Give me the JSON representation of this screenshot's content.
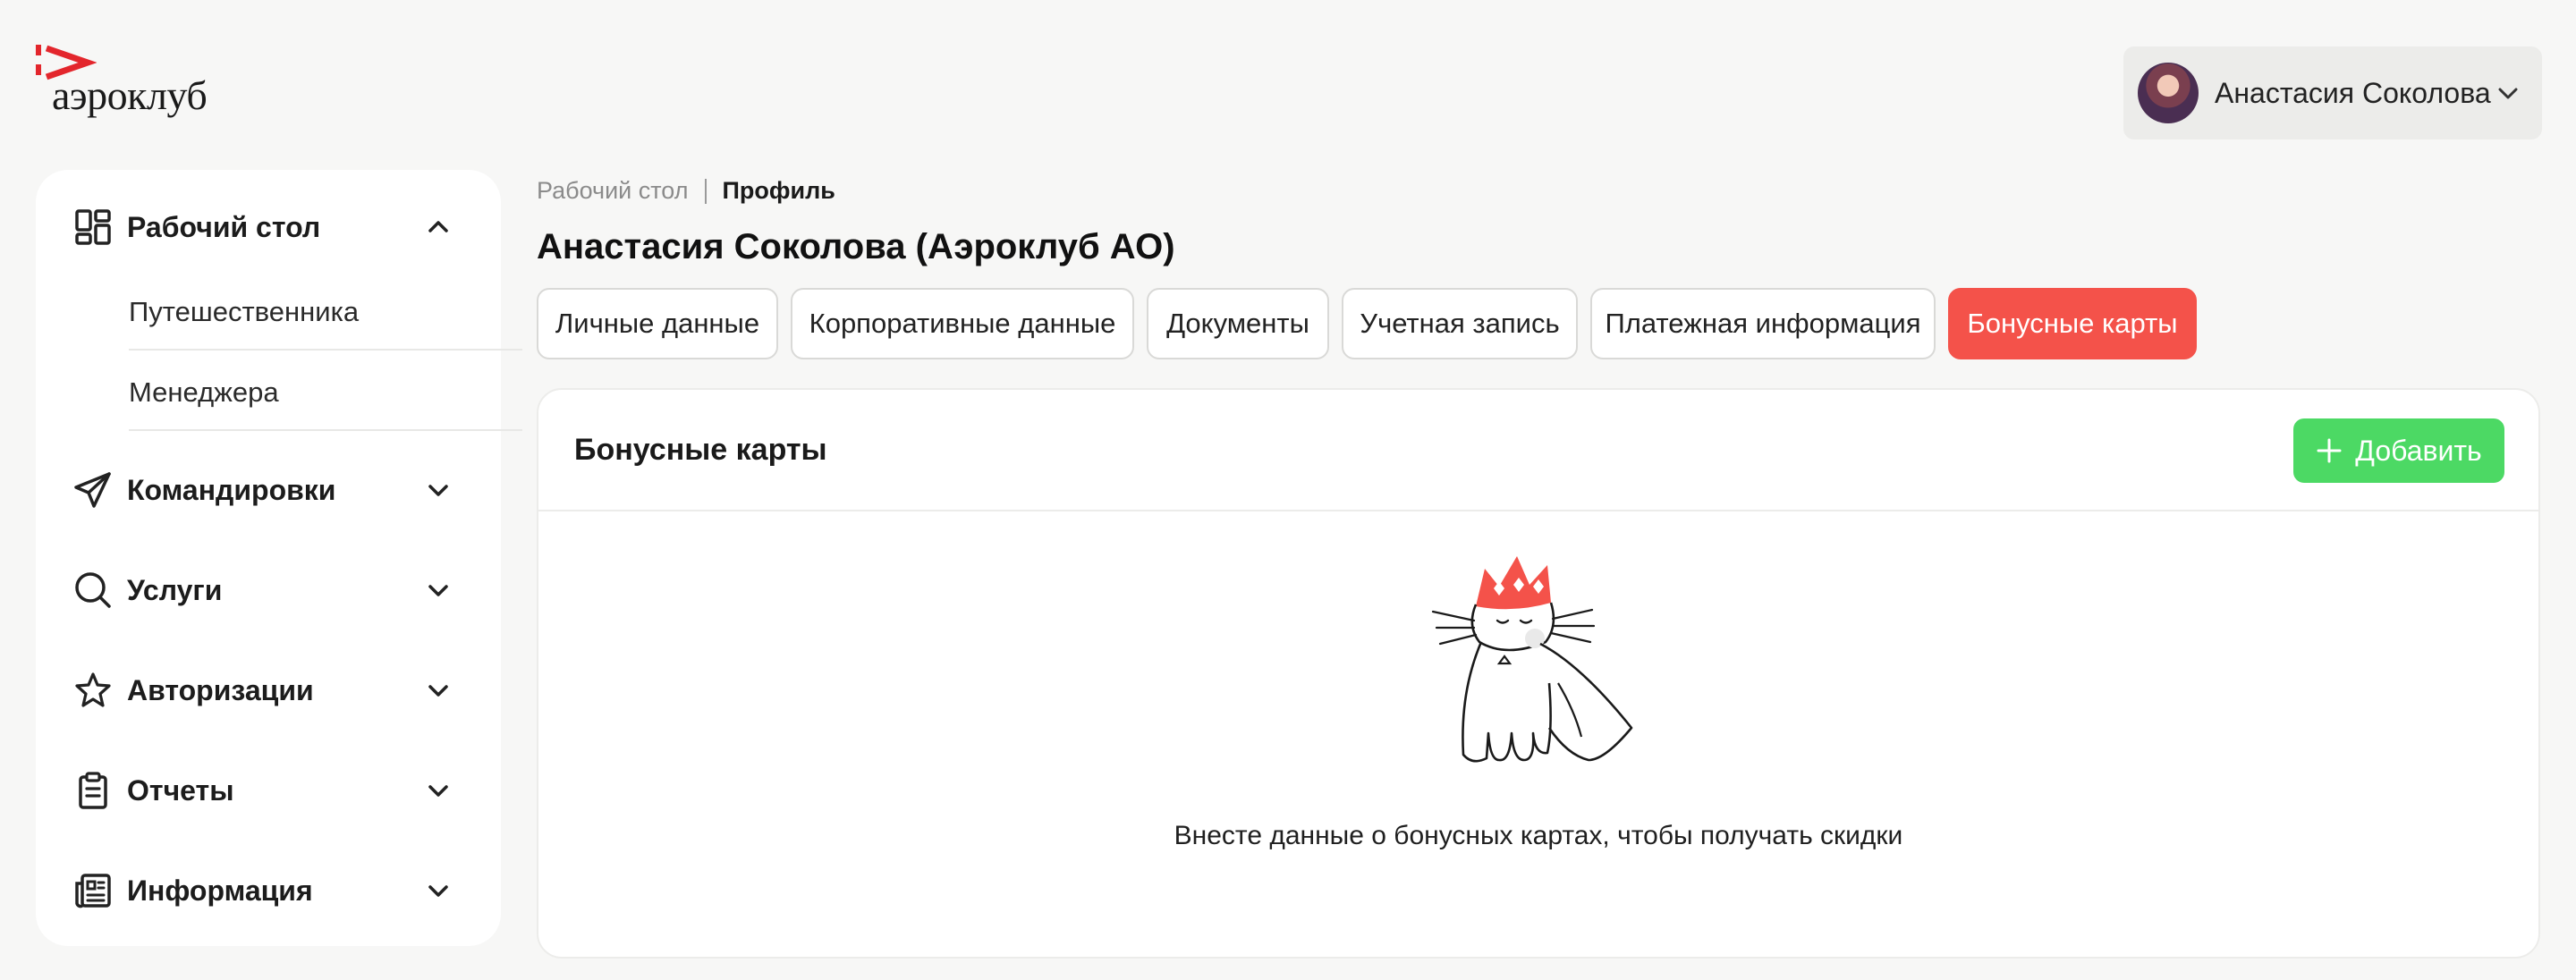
{
  "brand": {
    "logo_text": "аэроклуб",
    "accent": "#e3262c"
  },
  "user": {
    "name": "Анастасия Соколова"
  },
  "sidebar": {
    "sections": [
      {
        "label": "Рабочий стол",
        "icon": "dashboard-icon",
        "expanded": true,
        "children": [
          {
            "label": "Путешественника"
          },
          {
            "label": "Менеджера"
          }
        ]
      },
      {
        "label": "Командировки",
        "icon": "paper-plane-icon"
      },
      {
        "label": "Услуги",
        "icon": "search-icon"
      },
      {
        "label": "Авторизации",
        "icon": "star-icon"
      },
      {
        "label": "Отчеты",
        "icon": "clipboard-icon"
      },
      {
        "label": "Информация",
        "icon": "newspaper-icon"
      }
    ]
  },
  "breadcrumb": {
    "first": "Рабочий стол",
    "current": "Профиль"
  },
  "page": {
    "title": "Анастасия Соколова (Аэроклуб АО)"
  },
  "tabs": [
    {
      "label": "Личные данные"
    },
    {
      "label": "Корпоративные данные"
    },
    {
      "label": "Документы"
    },
    {
      "label": "Учетная запись"
    },
    {
      "label": "Платежная информация"
    },
    {
      "label": "Бонусные карты",
      "active": true
    }
  ],
  "card": {
    "title": "Бонусные карты",
    "add_label": "Добавить",
    "empty_text": "Внесте данные о бонусных картах, чтобы получать скидки"
  },
  "colors": {
    "active_tab": "#f4524a",
    "add_button": "#4cd964",
    "crown": "#f4524a"
  }
}
